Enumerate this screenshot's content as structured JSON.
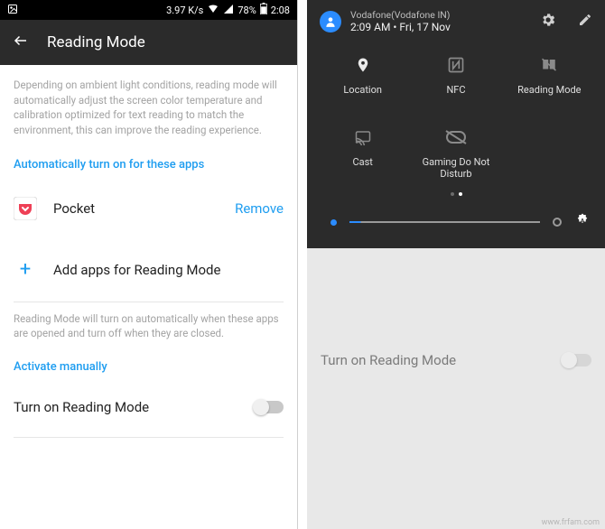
{
  "statusbar": {
    "speed": "3.97 K/s",
    "battery": "78%",
    "time": "2:08"
  },
  "appbar": {
    "title": "Reading Mode"
  },
  "left": {
    "description": "Depending on ambient light conditions, reading mode will automatically adjust the screen color temperature and calibration optimized for text reading to match the environment, this can improve the reading experience.",
    "section_auto": "Automatically turn on for these apps",
    "apps": [
      {
        "name": "Pocket",
        "action": "Remove"
      }
    ],
    "add_label": "Add apps for Reading Mode",
    "auto_note": "Reading Mode will turn on automatically when these apps are opened and turn off when they are closed.",
    "section_manual": "Activate manually",
    "toggle_label": "Turn on Reading Mode"
  },
  "right": {
    "carrier": "Vodafone(Vodafone IN)",
    "datetime": "2:09 AM • Fri, 17 Nov",
    "tiles": [
      "Location",
      "NFC",
      "Reading Mode",
      "Cast",
      "Gaming Do Not Disturb"
    ],
    "behind_toggle_label": "Turn on Reading Mode"
  },
  "watermark": "www.frfam.com"
}
